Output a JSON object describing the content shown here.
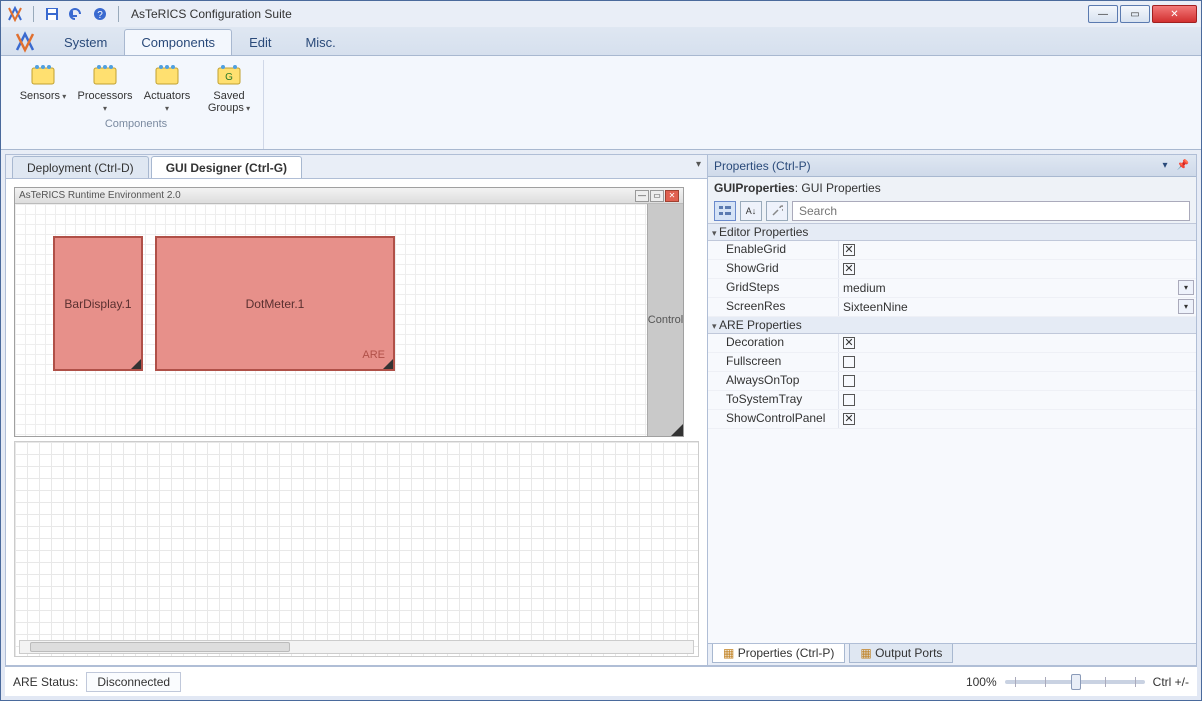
{
  "window": {
    "title": "AsTeRICS Configuration Suite"
  },
  "ribbon": {
    "tabs": [
      "System",
      "Components",
      "Edit",
      "Misc."
    ],
    "group_label": "Components",
    "items": [
      {
        "label": "Sensors"
      },
      {
        "label": "Processors"
      },
      {
        "label": "Actuators"
      },
      {
        "label": "Saved Groups"
      }
    ]
  },
  "doc_tabs": {
    "inactive": "Deployment (Ctrl-D)",
    "active": "GUI Designer (Ctrl-G)"
  },
  "designer": {
    "runtime_title": "AsTeRICS Runtime Environment 2.0",
    "comp1": "BarDisplay.1",
    "comp2": "DotMeter.1",
    "are_label": "ARE",
    "side_label": "Control"
  },
  "properties_panel": {
    "header": "Properties (Ctrl-P)",
    "title_bold": "GUIProperties",
    "title_rest": ": GUI Properties",
    "search_placeholder": "Search",
    "sections": {
      "editor": "Editor Properties",
      "are": "ARE Properties"
    },
    "rows": {
      "EnableGrid": {
        "label": "EnableGrid",
        "checked": true
      },
      "ShowGrid": {
        "label": "ShowGrid",
        "checked": true
      },
      "GridSteps": {
        "label": "GridSteps",
        "value": "medium",
        "dropdown": true
      },
      "ScreenRes": {
        "label": "ScreenRes",
        "value": "SixteenNine",
        "dropdown": true
      },
      "Decoration": {
        "label": "Decoration",
        "checked": true
      },
      "Fullscreen": {
        "label": "Fullscreen",
        "checked": false
      },
      "AlwaysOnTop": {
        "label": "AlwaysOnTop",
        "checked": false
      },
      "ToSystemTray": {
        "label": "ToSystemTray",
        "checked": false
      },
      "ShowControlPanel": {
        "label": "ShowControlPanel",
        "checked": true
      }
    },
    "bottom_tabs": {
      "props": "Properties (Ctrl-P)",
      "ports": "Output Ports"
    }
  },
  "statusbar": {
    "label": "ARE Status:",
    "value": "Disconnected",
    "zoom": "100%",
    "zoom_hint": "Ctrl +/-"
  }
}
